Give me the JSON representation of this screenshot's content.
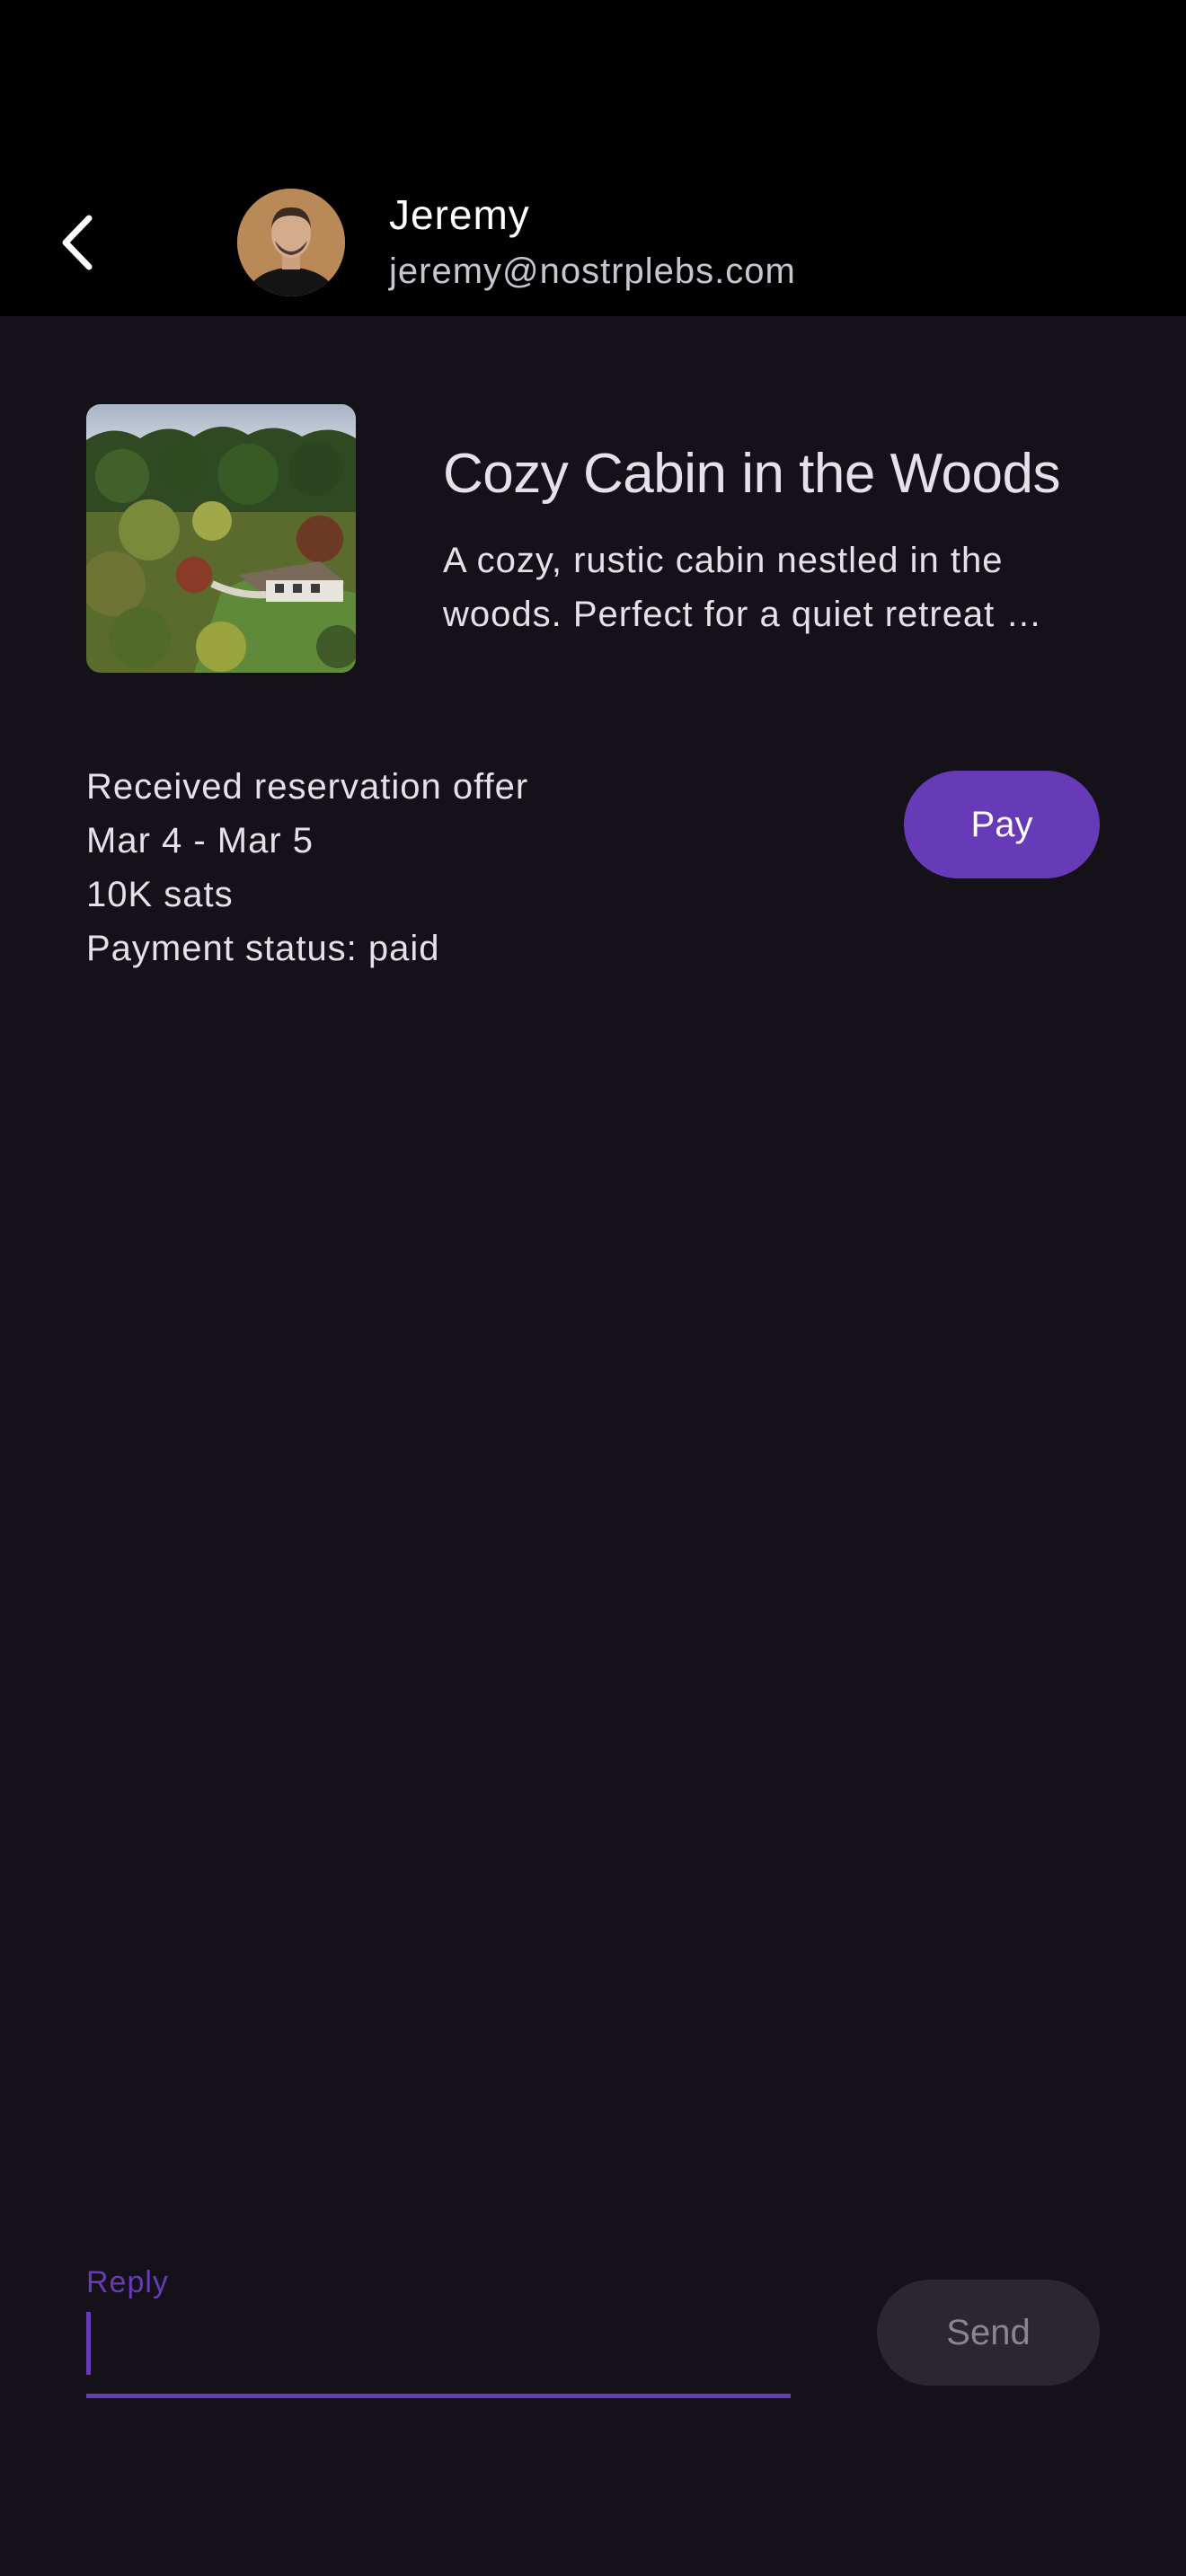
{
  "header": {
    "back_icon": "chevron-left-icon",
    "contact_name": "Jeremy",
    "contact_email": "jeremy@nostrplebs.com"
  },
  "listing": {
    "title": "Cozy Cabin in the Woods",
    "description": "A cozy, rustic cabin nestled in the woods. Perfect for a quiet retreat …"
  },
  "offer": {
    "status_line": "Received reservation offer",
    "dates": "Mar 4 - Mar 5",
    "price": "10K sats",
    "payment_status": "Payment status: paid",
    "pay_label": "Pay"
  },
  "composer": {
    "reply_label": "Reply",
    "reply_value": "",
    "send_label": "Send"
  },
  "colors": {
    "background": "#141218",
    "topbar": "#000000",
    "accent": "#673ab7",
    "send_disabled_bg": "#2a282e"
  }
}
